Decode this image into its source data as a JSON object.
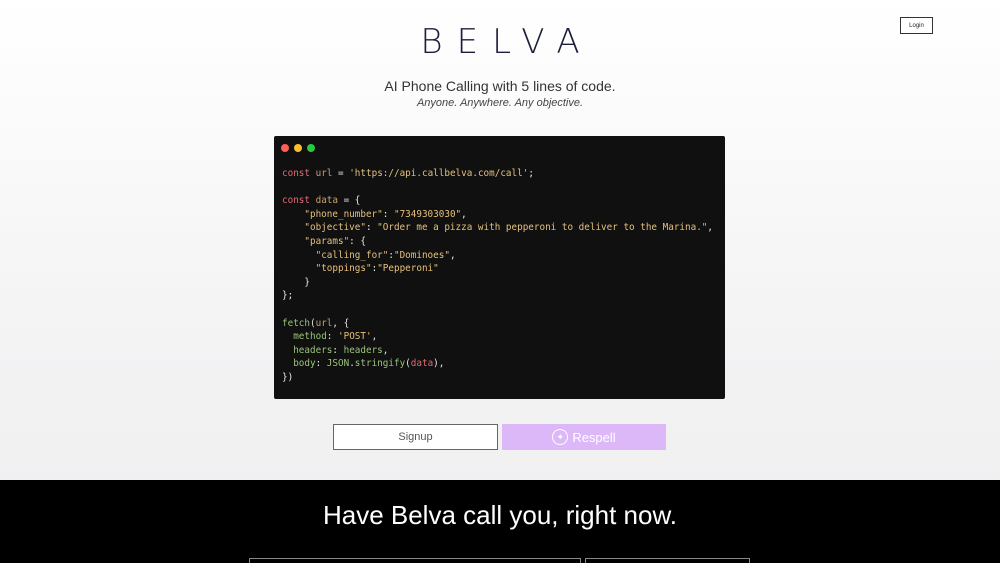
{
  "header": {
    "logo": "BELVA",
    "login_label": "Login"
  },
  "hero": {
    "tagline": "AI Phone Calling with 5 lines of code.",
    "subtagline": "Anyone. Anywhere. Any objective."
  },
  "code": {
    "url": "'https://api.callbelva.com/call'",
    "phone_number": "\"7349303030\"",
    "objective": "\"Order me a pizza with pepperoni to deliver to the Marina.\"",
    "calling_for": "\"Dominoes\"",
    "toppings": "\"Pepperoni\"",
    "method": "'POST'"
  },
  "actions": {
    "signup_label": "Signup",
    "respell_label": "Respell"
  },
  "cta": {
    "title": "Have Belva call you, right now."
  },
  "colors": {
    "accent": "#dcb8f8",
    "logo": "#1b1d3a"
  }
}
